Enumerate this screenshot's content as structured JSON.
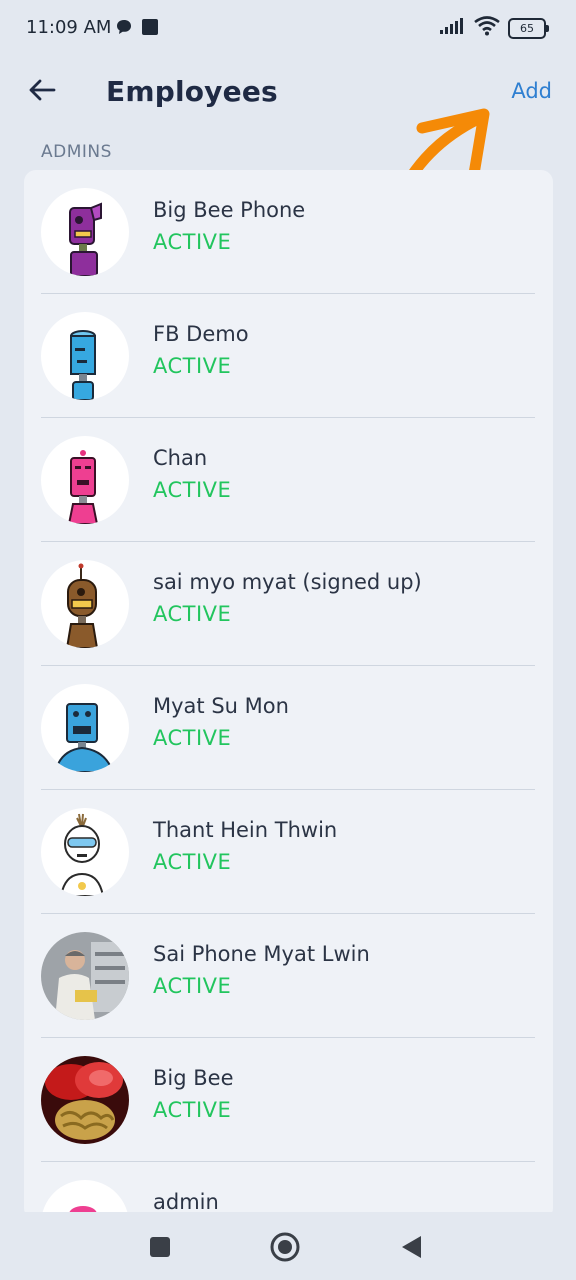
{
  "status_bar": {
    "time": "11:09 AM",
    "battery": "65",
    "icons": [
      "chat-bubble-icon",
      "notification-square-icon",
      "signal-icon",
      "wifi-icon",
      "battery-icon"
    ]
  },
  "header": {
    "title": "Employees",
    "add_label": "Add",
    "back_icon": "back-arrow-icon"
  },
  "section": {
    "label": "ADMINS"
  },
  "employees": [
    {
      "name": "Big Bee Phone",
      "status": "ACTIVE",
      "avatar": "purple-robot"
    },
    {
      "name": "FB Demo",
      "status": "ACTIVE",
      "avatar": "blue-robot"
    },
    {
      "name": "Chan",
      "status": "ACTIVE",
      "avatar": "pink-robot"
    },
    {
      "name": "sai myo myat (signed up)",
      "status": "ACTIVE",
      "avatar": "brown-robot"
    },
    {
      "name": "Myat Su Mon",
      "status": "ACTIVE",
      "avatar": "blue-robot-2"
    },
    {
      "name": "Thant Hein Thwin",
      "status": "ACTIVE",
      "avatar": "white-robot"
    },
    {
      "name": "Sai Phone Myat Lwin",
      "status": "ACTIVE",
      "avatar": "person-photo"
    },
    {
      "name": "Big Bee",
      "status": "ACTIVE",
      "avatar": "food-photo"
    },
    {
      "name": "admin",
      "status": "",
      "avatar": "pink-robot-partial"
    }
  ],
  "colors": {
    "background": "#e3e8f0",
    "card": "#eff2f7",
    "accent": "#2f7fd1",
    "status_active": "#22c55e",
    "annotation_arrow": "#f58a07"
  },
  "nav_bar": {
    "buttons": [
      "recents-square-icon",
      "home-circle-icon",
      "back-triangle-icon"
    ]
  }
}
